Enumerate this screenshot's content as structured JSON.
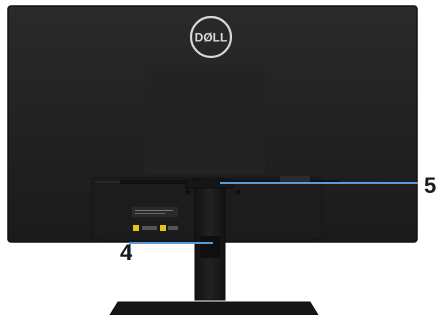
{
  "logo": {
    "text": "DØLL",
    "brand": "Dell"
  },
  "callouts": [
    {
      "number": "5"
    },
    {
      "number": "4"
    }
  ],
  "colors": {
    "monitor_body": "#1e1e1f",
    "monitor_edge": "#141414",
    "stand": "#171717",
    "callout_line": "#5b9bd5",
    "callout_text": "#1a1a1a"
  },
  "icons": [
    "dell-logo",
    "warning-label-icon"
  ]
}
